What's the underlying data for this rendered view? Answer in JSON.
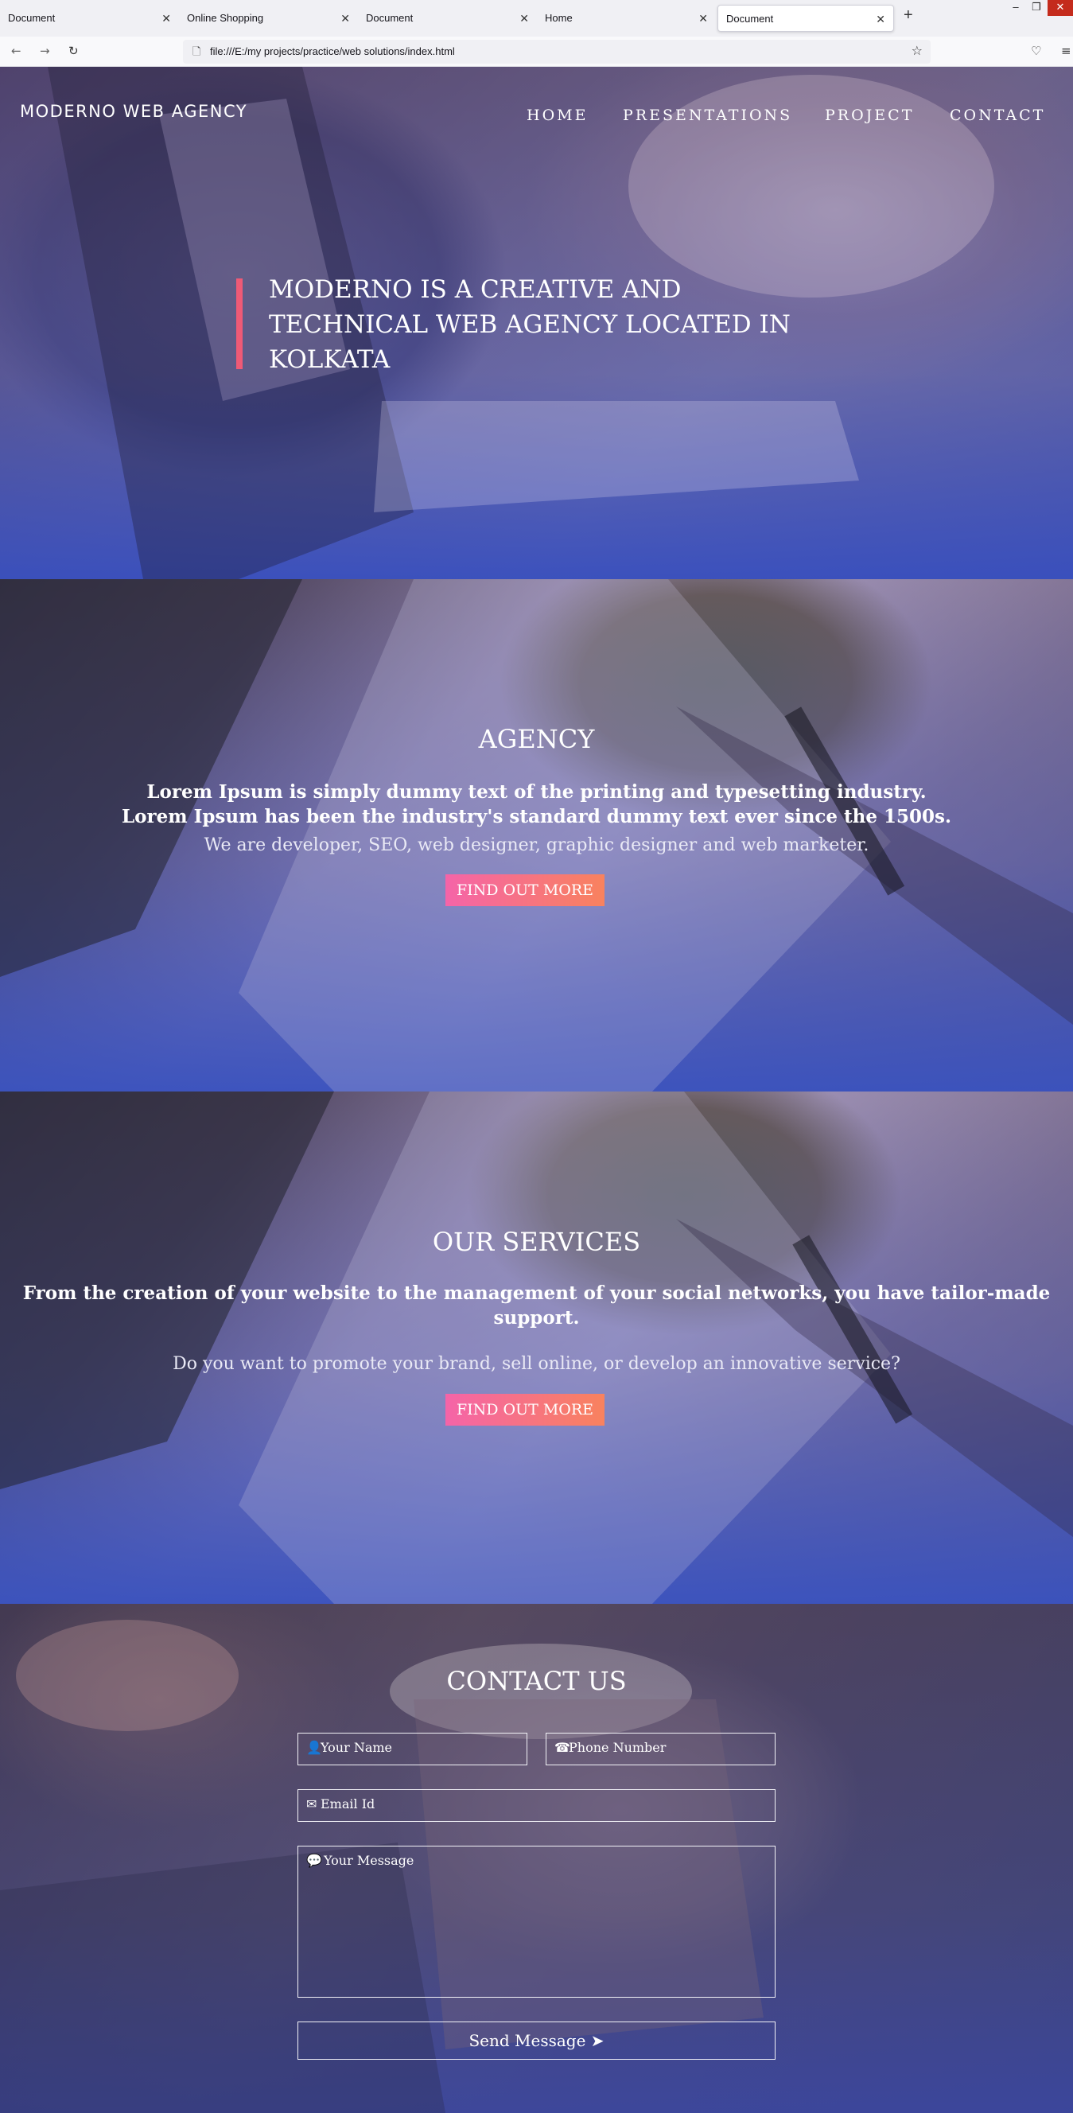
{
  "browser": {
    "tabs": [
      {
        "title": "Document"
      },
      {
        "title": "Online Shopping"
      },
      {
        "title": "Document"
      },
      {
        "title": "Home"
      },
      {
        "title": "Document"
      }
    ],
    "url": "file:///E:/my projects/practice/web solutions/index.html"
  },
  "site": {
    "brand": "MODERNO WEB AGENCY",
    "menu": [
      "HOME",
      "PRESENTATIONS",
      "PROJECT",
      "CONTACT"
    ]
  },
  "hero": {
    "line1": "MODERNO IS A CREATIVE AND",
    "line2": "TECHNICAL WEB AGENCY LOCATED IN",
    "line3": "KOLKATA"
  },
  "agency": {
    "title": "AGENCY",
    "lead1": "Lorem Ipsum is simply dummy text of the printing and typesetting industry.",
    "lead2": "Lorem Ipsum has been the industry's standard dummy text ever since the 1500s.",
    "sub": "We are developer, SEO, web designer, graphic designer and web marketer.",
    "button": "FIND OUT MORE"
  },
  "services": {
    "title": "OUR SERVICES",
    "lead1": "From the creation of your website to the management of your social networks, you have tailor-made",
    "lead2": "support.",
    "sub": "Do you want to promote your brand, sell online, or develop an innovative service?",
    "button": "FIND OUT MORE"
  },
  "contact": {
    "title": "CONTACT US",
    "name_placeholder": "Your Name",
    "phone_placeholder": "Phone Number",
    "email_placeholder": "Email Id",
    "message_placeholder": "Your Message",
    "send_label": "Send Message"
  },
  "icons": {
    "user": "user-icon",
    "phone": "phone-icon",
    "email": "envelope-icon",
    "message": "comments-icon",
    "send": "paper-plane-icon"
  },
  "colors": {
    "accent": "#ef5a76",
    "button_start": "#f564a8",
    "button_end": "#f8825e",
    "overlay_blue": "#3a52be"
  }
}
